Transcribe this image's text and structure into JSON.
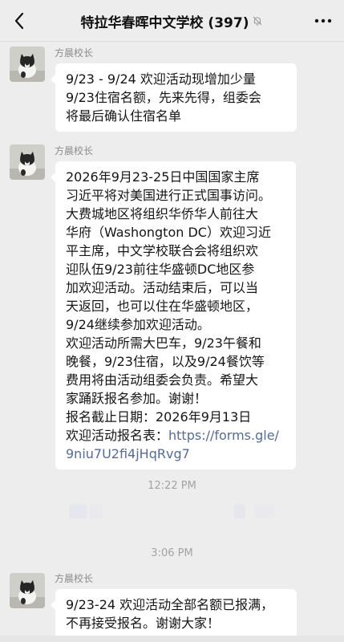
{
  "header": {
    "title": "特拉华春晖中文学校 (397)",
    "back_icon": "chevron-left-icon",
    "mute_icon": "bell-off-icon",
    "more_icon": "more-dots-icon"
  },
  "messages": [
    {
      "sender": "方晨校长",
      "lines": [
        "9/23 - 9/24 欢迎活动现增加少量",
        "9/23住宿名额，先来先得，组委会",
        "将最后确认住宿名单"
      ]
    },
    {
      "sender": "方晨校长",
      "lines": [
        "2026年9月23-25日中国国家主席",
        "习近平将对美国进行正式国事访问。",
        "大费城地区将组织华侨华人前往大",
        "华府（Washongton DC）欢迎习近",
        "平主席，中文学校联合会将组织欢",
        "迎队伍9/23前往华盛顿DC地区参",
        "加欢迎活动。活动结束后，可以当",
        "天返回，也可以住在华盛顿地区，",
        "9/24继续参加欢迎活动。",
        "欢迎活动所需大巴车，9/23午餐和",
        "晚餐，9/23住宿，以及9/24餐饮等",
        "费用将由活动组委会负责。希望大",
        "家踊跃报名参加。谢谢！",
        "报名截止日期：2026年9月13日",
        "欢迎活动报名表："
      ],
      "link_part1": "https://forms.gle/",
      "link_part2": "9niu7U2fi4jHqRvg7"
    },
    {
      "sender": "方晨校长",
      "lines": [
        "9/23-24 欢迎活动全部名额已报满，",
        "不再接受报名。谢谢大家！"
      ]
    }
  ],
  "timestamps": [
    "12:22 PM",
    "3:06 PM"
  ],
  "colors": {
    "background": "#ededed",
    "bubble": "#ffffff",
    "link": "#576b95",
    "meta_text": "#8c8c8c"
  }
}
